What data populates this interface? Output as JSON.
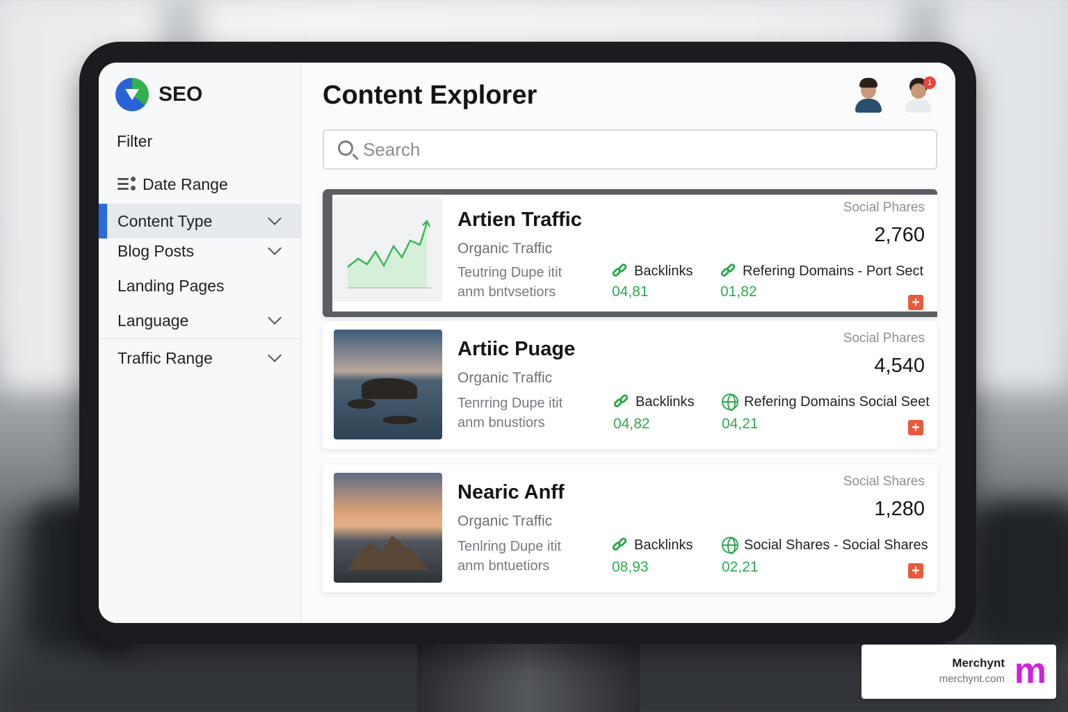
{
  "sidebar": {
    "brand": "SEO",
    "filter_title": "Filter",
    "items": [
      {
        "label": "Date Range"
      },
      {
        "label": "Content Type"
      },
      {
        "label": "Blog Posts"
      },
      {
        "label": "Landing Pages"
      },
      {
        "label": "Language"
      },
      {
        "label": "Traffic Range"
      }
    ]
  },
  "header": {
    "title": "Content Explorer",
    "notification_count": "1"
  },
  "search": {
    "placeholder": "Search"
  },
  "cards": [
    {
      "title": "Artien Traffic",
      "subtitle": "Organic Traffic",
      "desc_line1": "Teutring Dupe itit",
      "desc_line2": "anm bntvsetiors",
      "social_label": "Social Phares",
      "social_value": "2,760",
      "metric1_label": "Backlinks",
      "metric1_value": "04,81",
      "metric2_label": "Refering Domains - Port Sect",
      "metric2_value": "01,82",
      "thumbnail": "line-chart"
    },
    {
      "title": "Artiic Puage",
      "subtitle": "Organic Traffic",
      "desc_line1": "Tenrring Dupe itit",
      "desc_line2": "anm bnustiors",
      "social_label": "Social Phares",
      "social_value": "4,540",
      "metric1_label": "Backlinks",
      "metric1_value": "04,82",
      "metric2_label": "Refering Domains Social Seet",
      "metric2_value": "04,21",
      "thumbnail": "seascape"
    },
    {
      "title": "Nearic Anff",
      "subtitle": "Organic Traffic",
      "desc_line1": "Tenlring Dupe itit",
      "desc_line2": "anm bntuetiors",
      "social_label": "Social Shares",
      "social_value": "1,280",
      "metric1_label": "Backlinks",
      "metric1_value": "08,93",
      "metric2_label": "Social Shares - Social Shares",
      "metric2_value": "02,21",
      "thumbnail": "sunset-rock"
    }
  ],
  "badge": {
    "name": "Merchynt",
    "url": "merchynt.com",
    "logo_letter": "m"
  },
  "colors": {
    "accent": "#2a6ae0",
    "positive": "#2fa84f",
    "add_button": "#ea5a3a",
    "badge_logo": "#d21fe0"
  }
}
